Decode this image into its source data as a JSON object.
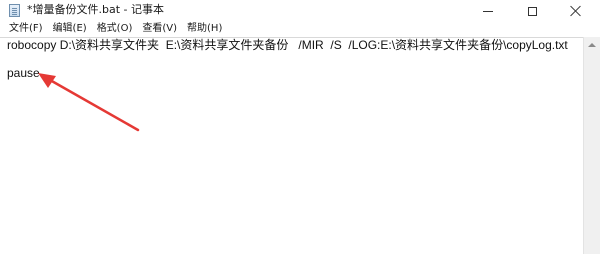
{
  "window": {
    "title": "*增量备份文件.bat - 记事本",
    "app_icon": "notepad-icon",
    "controls": {
      "minimize_icon": "minimize-icon",
      "maximize_icon": "maximize-icon",
      "close_icon": "close-icon"
    }
  },
  "menubar": {
    "items": [
      {
        "label": "文件(F)"
      },
      {
        "label": "编辑(E)"
      },
      {
        "label": "格式(O)"
      },
      {
        "label": "查看(V)"
      },
      {
        "label": "帮助(H)"
      }
    ]
  },
  "editor": {
    "lines": [
      "robocopy D:\\资料共享文件夹  E:\\资料共享文件夹备份   /MIR  /S  /LOG:E:\\资料共享文件夹备份\\copyLog.txt",
      "pause"
    ]
  },
  "annotation": {
    "color": "#e53935"
  }
}
